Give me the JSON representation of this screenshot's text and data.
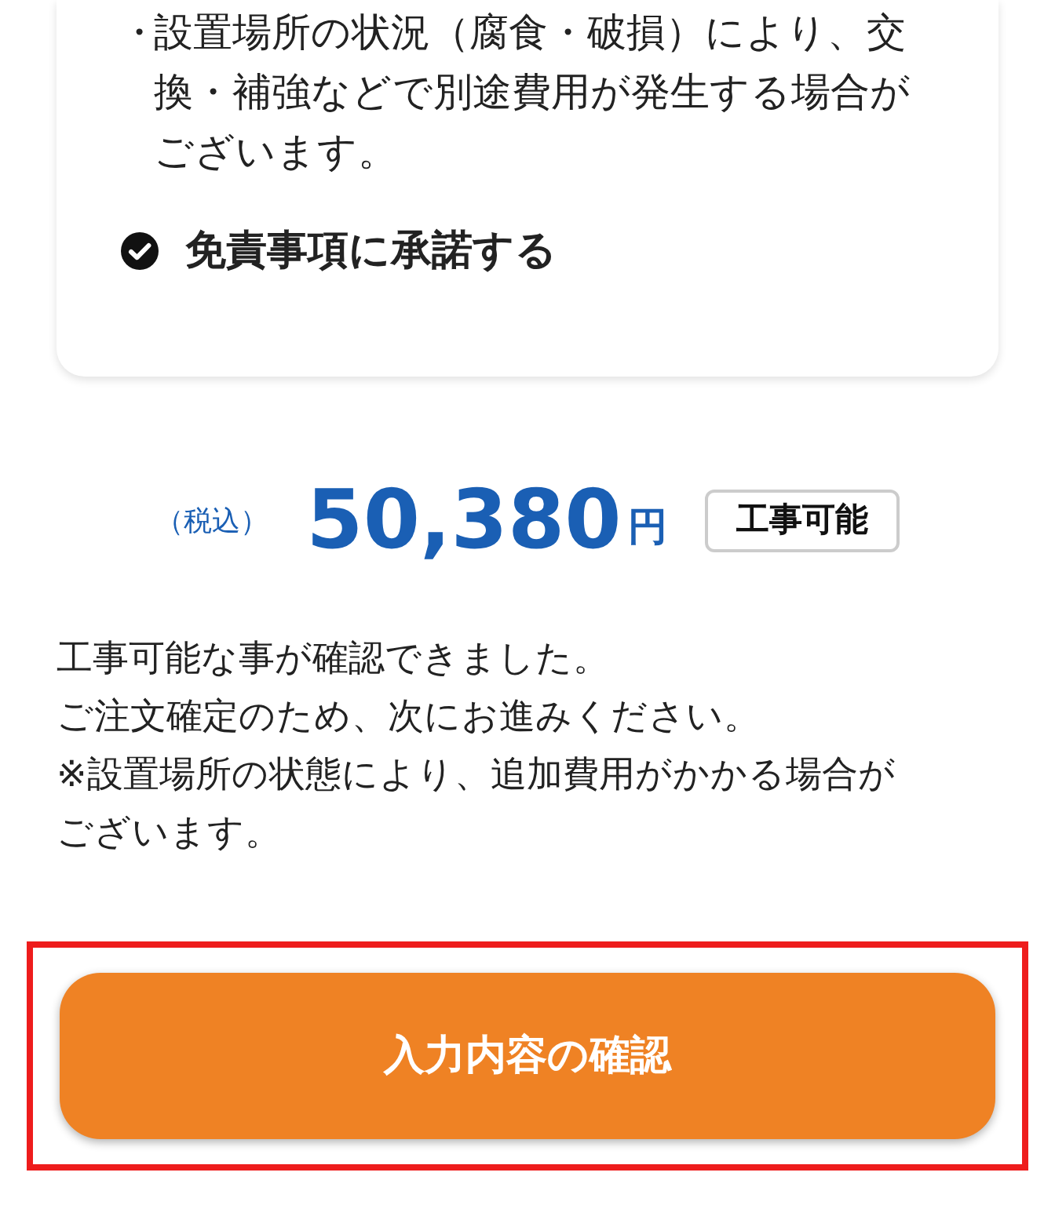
{
  "disclaimer_card": {
    "bullets": [
      "設置場所の状況（腐食・破損）により、交換・補強などで別途費用が発生する場合がございます。"
    ],
    "bullet_mark": "・",
    "agree": {
      "label": "免責事項に承諾する",
      "checked": true
    }
  },
  "price": {
    "tax_note": "（税込）",
    "amount": "50,380",
    "unit": "円",
    "status_badge": "工事可能"
  },
  "message": [
    "工事可能な事が確認できました。",
    "ご注文確定のため、次にお進みください。",
    "※設置場所の状態により、追加費用がかかる場合がございます。"
  ],
  "confirm_button": {
    "label": "入力内容の確認",
    "highlighted": true
  }
}
